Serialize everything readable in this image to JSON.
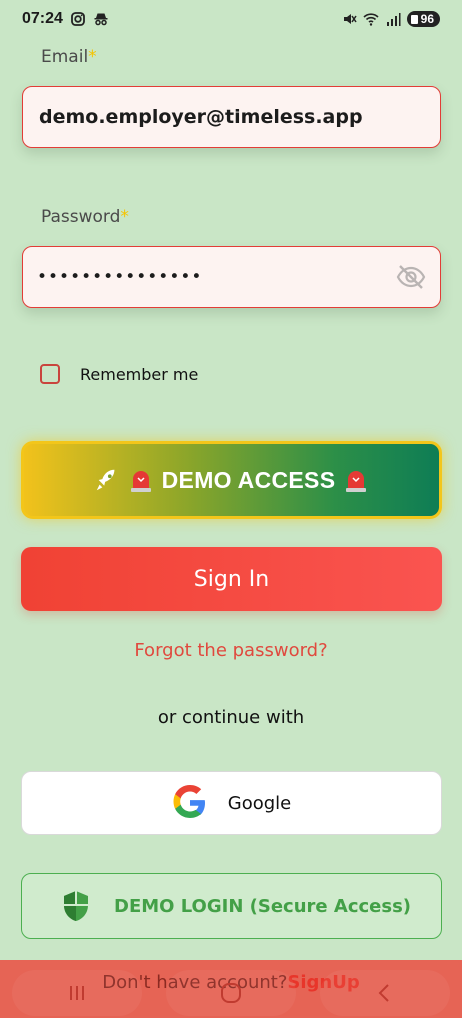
{
  "status": {
    "time": "07:24",
    "battery": "96"
  },
  "email": {
    "label": "Email",
    "required_mark": "*",
    "value": "demo.employer@timeless.app"
  },
  "password": {
    "label": "Password",
    "required_mark": "*",
    "masked": "•••••••••••••••"
  },
  "remember": {
    "label": "Remember me",
    "checked": false
  },
  "demo_access": {
    "label": "DEMO ACCESS"
  },
  "signin": {
    "label": "Sign In"
  },
  "forgot": {
    "label": "Forgot the password?"
  },
  "continue": {
    "label": "or continue with"
  },
  "google": {
    "label": "Google"
  },
  "demo_login": {
    "label": "DEMO LOGIN (Secure Access)"
  },
  "signup": {
    "prompt": "Don't have account?",
    "link": "SignUp"
  },
  "colors": {
    "background": "#c9e6c6",
    "accent_red": "#f04234",
    "accent_green": "#43a047",
    "gold": "#f3c61a"
  }
}
